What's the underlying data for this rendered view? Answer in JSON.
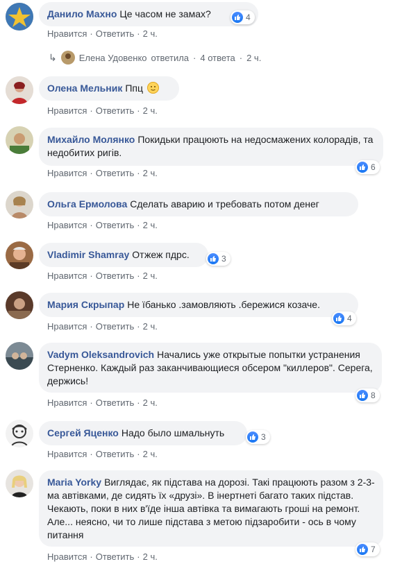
{
  "colors": {
    "author": "#385898",
    "bubble": "#f2f3f5",
    "meta": "#606770",
    "like": "#1877f2"
  },
  "actions": {
    "like": "Нравится",
    "reply": "Ответить",
    "sep": "·"
  },
  "reply_summary": {
    "author": "Елена Удовенко",
    "verb": "ответила",
    "count": "4 ответа",
    "time": "2 ч."
  },
  "comments": [
    {
      "author": "Данило Махно",
      "text": "Це часом не замах?",
      "reactions": "4",
      "time": "2 ч."
    },
    {
      "author": "Олена Мельник",
      "text": "Ппц",
      "emoji": "slightly-smiling-face",
      "time": "2 ч."
    },
    {
      "author": "Михайло Молянко",
      "text": "Покидьки працюють на недосмажених колорадів, та недобитих ригів.",
      "reactions": "6",
      "time": "2 ч."
    },
    {
      "author": "Ольга Ермолова",
      "text": "Сделать аварию и требовать потом денег",
      "time": "2 ч."
    },
    {
      "author": "Vladimir Shamray",
      "text": "Отжеж пдрс.",
      "reactions": "3",
      "time": "2 ч."
    },
    {
      "author": "Мария Скрыпар",
      "text": "Не їбанько .замовляють .бережися козаче.",
      "reactions": "4",
      "time": "2 ч."
    },
    {
      "author": "Vadym Oleksandrovich",
      "text": "Начались уже открытые попытки устранения Стерненко. Каждый раз заканчивающиеся обсером \"киллеров\". Серега, держись!",
      "reactions": "8",
      "time": "2 ч."
    },
    {
      "author": "Сергей Яценко",
      "text": "Надо было шмальнуть",
      "reactions": "3",
      "time": "2 ч."
    },
    {
      "author": "Maria Yorky",
      "text": "Виглядає, як підстава на дорозі. Такі працюють разом з 2-3-ма автівками, де сидять їх «друзі». В інертнеті багато таких підстав. Чекають, поки в них в'їде інша автівка та вимагають гроші на ремонт. Але... неясно, чи то лише підстава з метою підзаробити - ось в чому питання",
      "reactions": "7",
      "time": "2 ч."
    }
  ]
}
